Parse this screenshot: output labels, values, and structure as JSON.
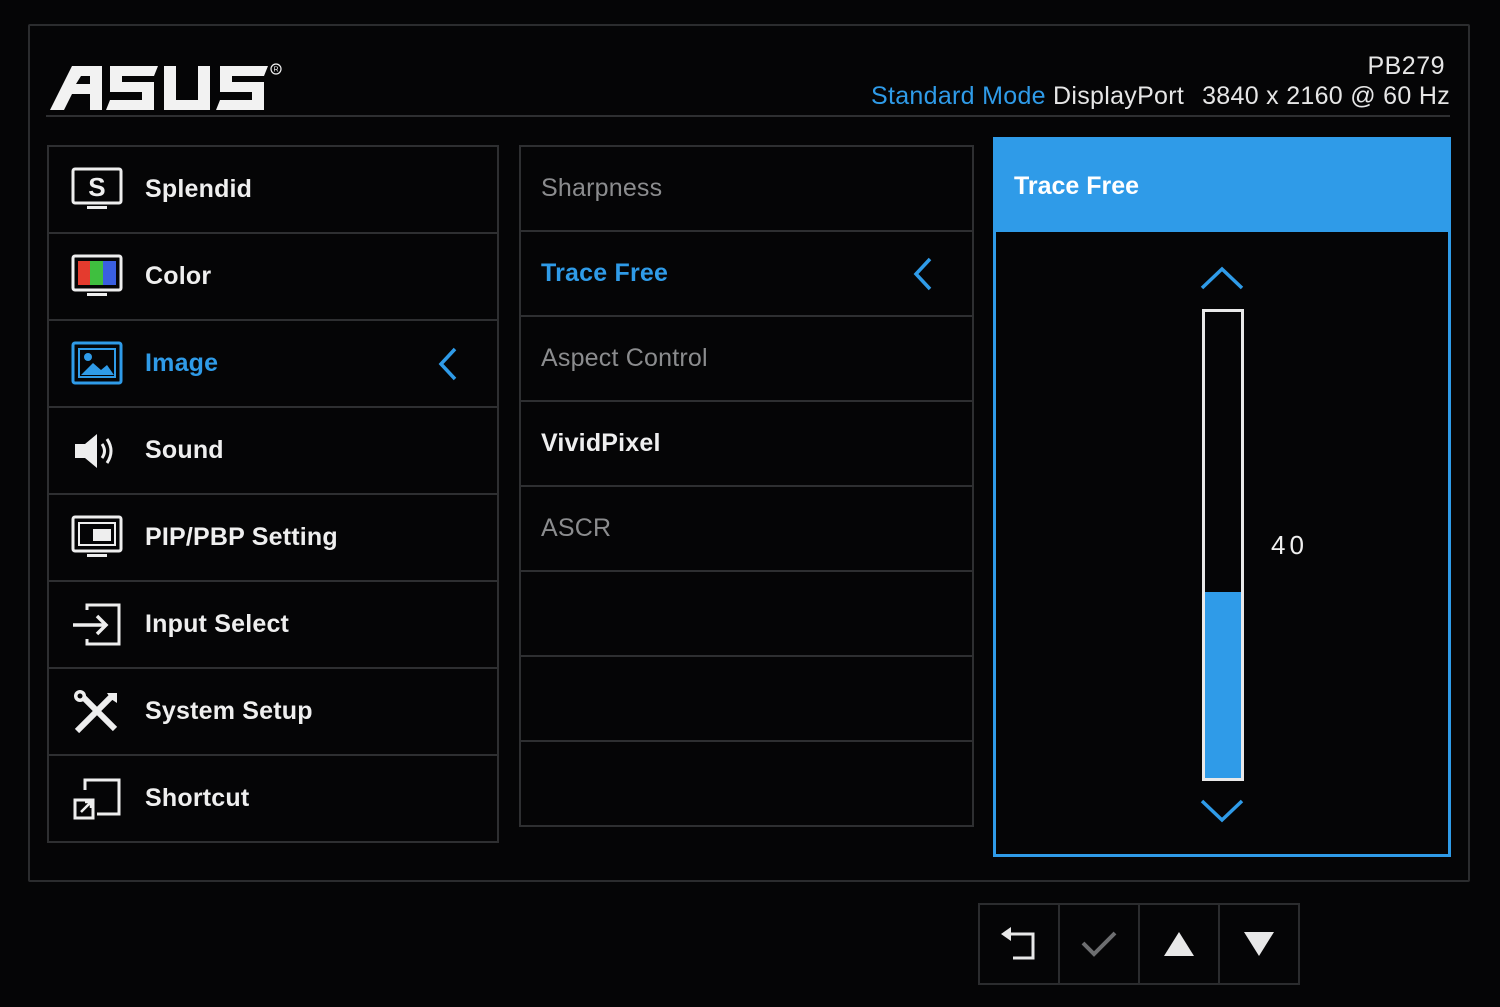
{
  "brand": "ASUS",
  "header": {
    "model": "PB279",
    "mode": "Standard Mode",
    "input": "DisplayPort",
    "resolution": "3840 x 2160 @ 60 Hz"
  },
  "main_menu": [
    {
      "label": "Splendid",
      "icon": "splendid-icon"
    },
    {
      "label": "Color",
      "icon": "color-icon"
    },
    {
      "label": "Image",
      "icon": "image-icon",
      "active": true
    },
    {
      "label": "Sound",
      "icon": "speaker-icon"
    },
    {
      "label": "PIP/PBP Setting",
      "icon": "monitor-icon"
    },
    {
      "label": "Input Select",
      "icon": "input-icon"
    },
    {
      "label": "System Setup",
      "icon": "tools-icon"
    },
    {
      "label": "Shortcut",
      "icon": "shortcut-icon"
    }
  ],
  "sub_menu": [
    {
      "label": "Sharpness",
      "state": "disabled"
    },
    {
      "label": "Trace Free",
      "state": "selected"
    },
    {
      "label": "Aspect Control",
      "state": "disabled"
    },
    {
      "label": "VividPixel",
      "state": "enabled"
    },
    {
      "label": "ASCR",
      "state": "disabled"
    },
    {
      "label": ""
    },
    {
      "label": ""
    },
    {
      "label": ""
    }
  ],
  "setting_panel": {
    "title": "Trace Free",
    "value": "40",
    "level_percent": 40
  },
  "buttons": [
    {
      "name": "back-button",
      "icon": "back-arrow-icon"
    },
    {
      "name": "confirm-button",
      "icon": "checkmark-icon"
    },
    {
      "name": "up-button",
      "icon": "up-triangle-icon"
    },
    {
      "name": "down-button",
      "icon": "down-triangle-icon"
    }
  ],
  "colors": {
    "accent": "#2f9be8",
    "text": "#efefef",
    "dim_text": "#8b8c8e",
    "background": "#050506"
  }
}
